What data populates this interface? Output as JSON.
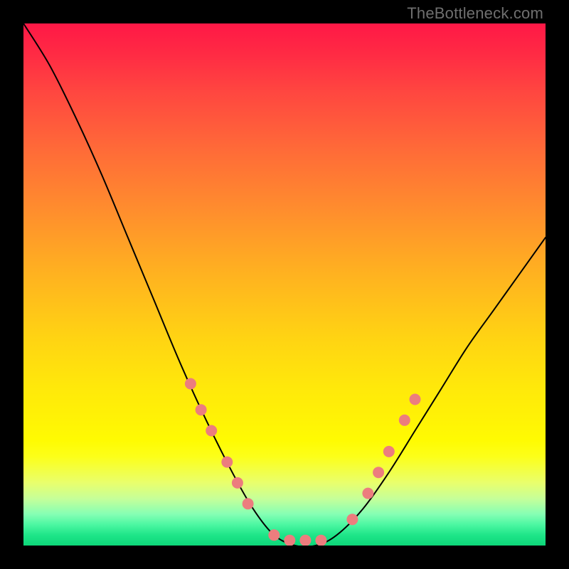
{
  "watermark": {
    "text": "TheBottleneck.com"
  },
  "chart_data": {
    "type": "line",
    "title": "",
    "xlabel": "",
    "ylabel": "",
    "xlim": [
      0,
      100
    ],
    "ylim": [
      0,
      100
    ],
    "grid": false,
    "legend": false,
    "axes_visible": false,
    "background_gradient": {
      "direction": "vertical",
      "stops": [
        {
          "pos": 0.0,
          "color": "#ff1846"
        },
        {
          "pos": 0.5,
          "color": "#ffc818"
        },
        {
          "pos": 0.8,
          "color": "#fffb02"
        },
        {
          "pos": 1.0,
          "color": "#0dd779"
        }
      ]
    },
    "series": [
      {
        "name": "bottleneck-curve",
        "stroke": "#000000",
        "stroke_width": 2,
        "x": [
          0,
          5,
          10,
          15,
          20,
          25,
          30,
          35,
          40,
          44,
          48,
          52,
          56,
          60,
          65,
          70,
          75,
          80,
          85,
          90,
          95,
          100
        ],
        "values": [
          100,
          92,
          82,
          71,
          59,
          47,
          35,
          24,
          14,
          7,
          2,
          0,
          0,
          2,
          7,
          14,
          22,
          30,
          38,
          45,
          52,
          59
        ]
      }
    ],
    "markers": {
      "color": "#ec7d7e",
      "radius": 8,
      "points": [
        {
          "x": 32,
          "y": 31
        },
        {
          "x": 34,
          "y": 26
        },
        {
          "x": 36,
          "y": 22
        },
        {
          "x": 39,
          "y": 16
        },
        {
          "x": 41,
          "y": 12
        },
        {
          "x": 43,
          "y": 8
        },
        {
          "x": 48,
          "y": 2
        },
        {
          "x": 51,
          "y": 1
        },
        {
          "x": 54,
          "y": 1
        },
        {
          "x": 57,
          "y": 1
        },
        {
          "x": 63,
          "y": 5
        },
        {
          "x": 66,
          "y": 10
        },
        {
          "x": 68,
          "y": 14
        },
        {
          "x": 70,
          "y": 18
        },
        {
          "x": 73,
          "y": 24
        },
        {
          "x": 75,
          "y": 28
        }
      ]
    }
  }
}
